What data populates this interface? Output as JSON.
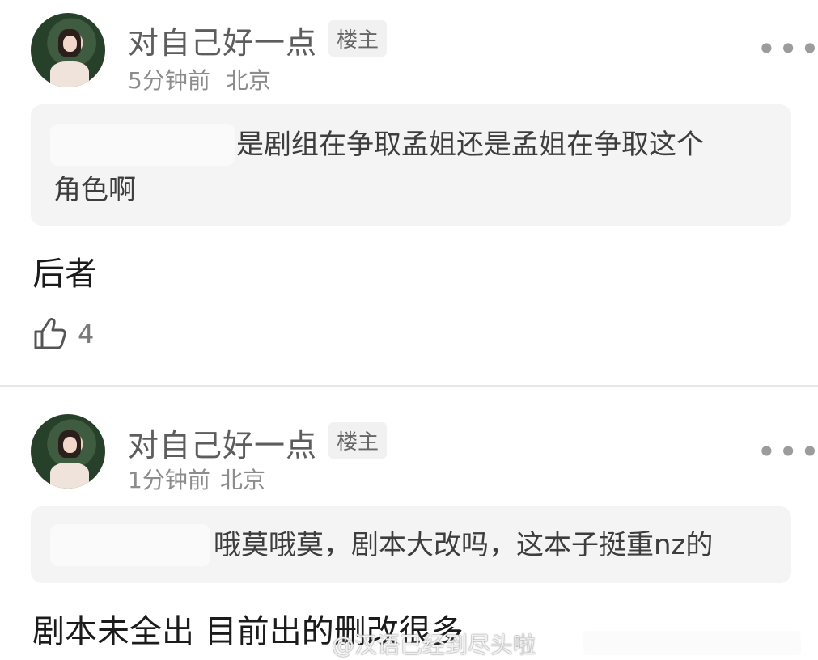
{
  "comments": [
    {
      "username": "对自己好一点",
      "badge": "楼主",
      "time": "5分钟前",
      "location": "北京",
      "quote_visible_text": "是剧组在争取孟姐还是孟姐在争取这个",
      "quote_line2": "角色啊",
      "reply": "后者",
      "likes": "4"
    },
    {
      "username": "对自己好一点",
      "badge": "楼主",
      "time": "1分钟前",
      "location": "北京",
      "quote_visible_text": "哦莫哦莫，剧本大改吗，这本子挺重nz的",
      "reply": "剧本未全出 目前出的删改很多"
    }
  ],
  "more_glyph": "•••",
  "watermark": "@汉语已经到尽头啦"
}
